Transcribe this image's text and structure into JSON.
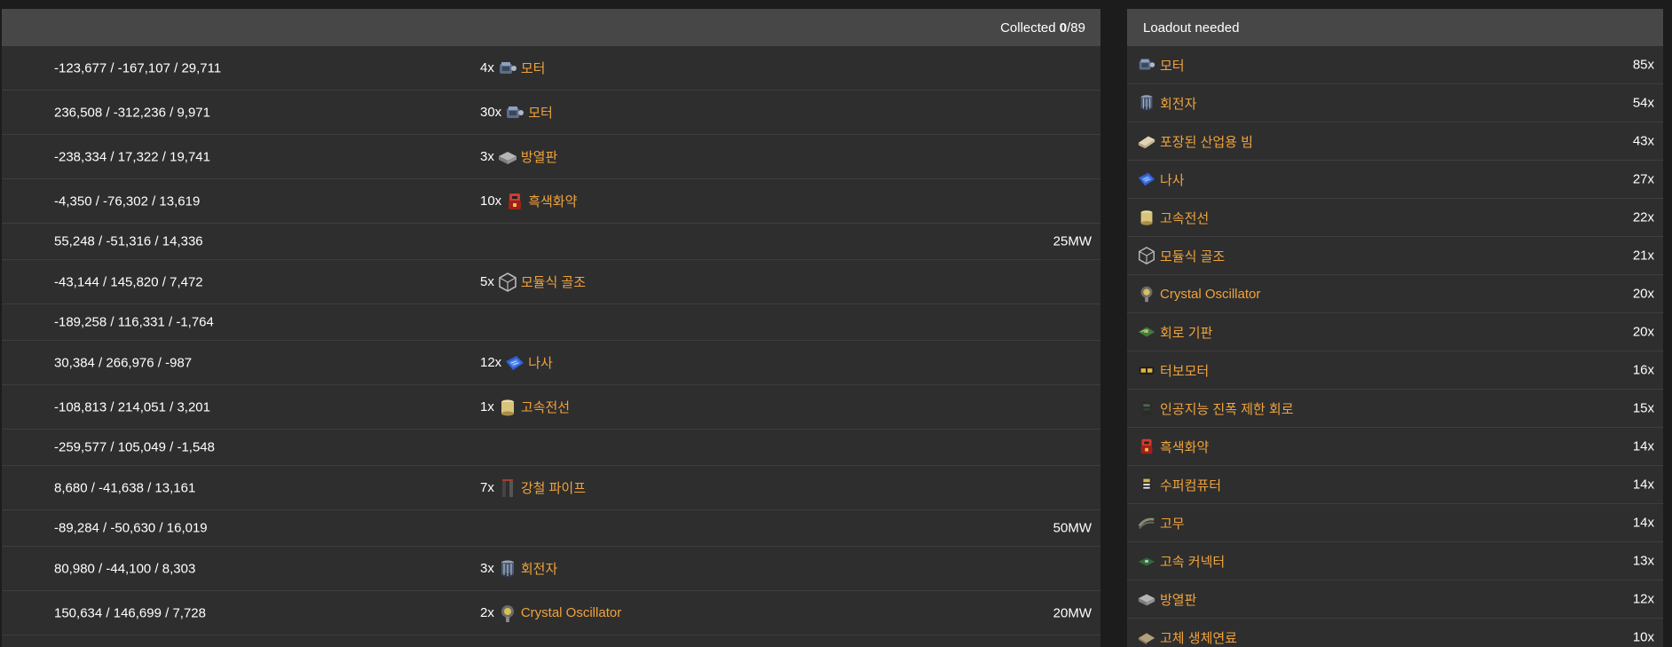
{
  "collected": {
    "label": "Collected",
    "count": "0",
    "total": "/89"
  },
  "loadout_title": "Loadout needed",
  "rows": [
    {
      "coords": "-123,677 / -167,107 / 29,711",
      "qty": "4x",
      "name": "모터",
      "icon": "motor-icon",
      "power": ""
    },
    {
      "coords": "236,508 / -312,236 / 9,971",
      "qty": "30x",
      "name": "모터",
      "icon": "motor-icon",
      "power": ""
    },
    {
      "coords": "-238,334 / 17,322 / 19,741",
      "qty": "3x",
      "name": "방열판",
      "icon": "heat-sink-icon",
      "power": ""
    },
    {
      "coords": "-4,350 / -76,302 / 13,619",
      "qty": "10x",
      "name": "흑색화약",
      "icon": "black-powder-icon",
      "power": ""
    },
    {
      "coords": "55,248 / -51,316 / 14,336",
      "qty": "",
      "name": "",
      "icon": "",
      "power": "25MW"
    },
    {
      "coords": "-43,144 / 145,820 / 7,472",
      "qty": "5x",
      "name": "모듈식 골조",
      "icon": "modular-frame-icon",
      "power": ""
    },
    {
      "coords": "-189,258 / 116,331 / -1,764",
      "qty": "",
      "name": "",
      "icon": "",
      "power": ""
    },
    {
      "coords": "30,384 / 266,976 / -987",
      "qty": "12x",
      "name": "나사",
      "icon": "screw-icon",
      "power": ""
    },
    {
      "coords": "-108,813 / 214,051 / 3,201",
      "qty": "1x",
      "name": "고속전선",
      "icon": "quickwire-icon",
      "power": ""
    },
    {
      "coords": "-259,577 / 105,049 / -1,548",
      "qty": "",
      "name": "",
      "icon": "",
      "power": ""
    },
    {
      "coords": "8,680 / -41,638 / 13,161",
      "qty": "7x",
      "name": "강철 파이프",
      "icon": "steel-pipe-icon",
      "power": ""
    },
    {
      "coords": "-89,284 / -50,630 / 16,019",
      "qty": "",
      "name": "",
      "icon": "",
      "power": "50MW"
    },
    {
      "coords": "80,980 / -44,100 / 8,303",
      "qty": "3x",
      "name": "회전자",
      "icon": "rotor-icon",
      "power": ""
    },
    {
      "coords": "150,634 / 146,699 / 7,728",
      "qty": "2x",
      "name": "Crystal Oscillator",
      "icon": "crystal-oscillator-icon",
      "power": "20MW"
    },
    {
      "coords": "",
      "qty": "",
      "name": "",
      "icon": "",
      "power": ""
    }
  ],
  "loadout": [
    {
      "name": "모터",
      "count": "85x",
      "icon": "motor-icon"
    },
    {
      "name": "회전자",
      "count": "54x",
      "icon": "rotor-icon"
    },
    {
      "name": "포장된 산업용 빔",
      "count": "43x",
      "icon": "encased-beam-icon"
    },
    {
      "name": "나사",
      "count": "27x",
      "icon": "screw-icon"
    },
    {
      "name": "고속전선",
      "count": "22x",
      "icon": "quickwire-icon"
    },
    {
      "name": "모듈식 골조",
      "count": "21x",
      "icon": "modular-frame-icon"
    },
    {
      "name": "Crystal Oscillator",
      "count": "20x",
      "icon": "crystal-oscillator-icon"
    },
    {
      "name": "회로 기판",
      "count": "20x",
      "icon": "circuit-board-icon"
    },
    {
      "name": "터보모터",
      "count": "16x",
      "icon": "turbo-motor-icon"
    },
    {
      "name": "인공지능 진폭 제한 회로",
      "count": "15x",
      "icon": "ai-limiter-icon"
    },
    {
      "name": "흑색화약",
      "count": "14x",
      "icon": "black-powder-icon"
    },
    {
      "name": "수퍼컴퓨터",
      "count": "14x",
      "icon": "supercomputer-icon"
    },
    {
      "name": "고무",
      "count": "14x",
      "icon": "rubber-icon"
    },
    {
      "name": "고속 커넥터",
      "count": "13x",
      "icon": "connector-icon"
    },
    {
      "name": "방열판",
      "count": "12x",
      "icon": "heat-sink-icon"
    },
    {
      "name": "고체 생체연료",
      "count": "10x",
      "icon": "biofuel-icon"
    }
  ],
  "colors": {
    "accent": "#f0a33c",
    "panel": "#2e2e2e",
    "header": "#474747"
  }
}
